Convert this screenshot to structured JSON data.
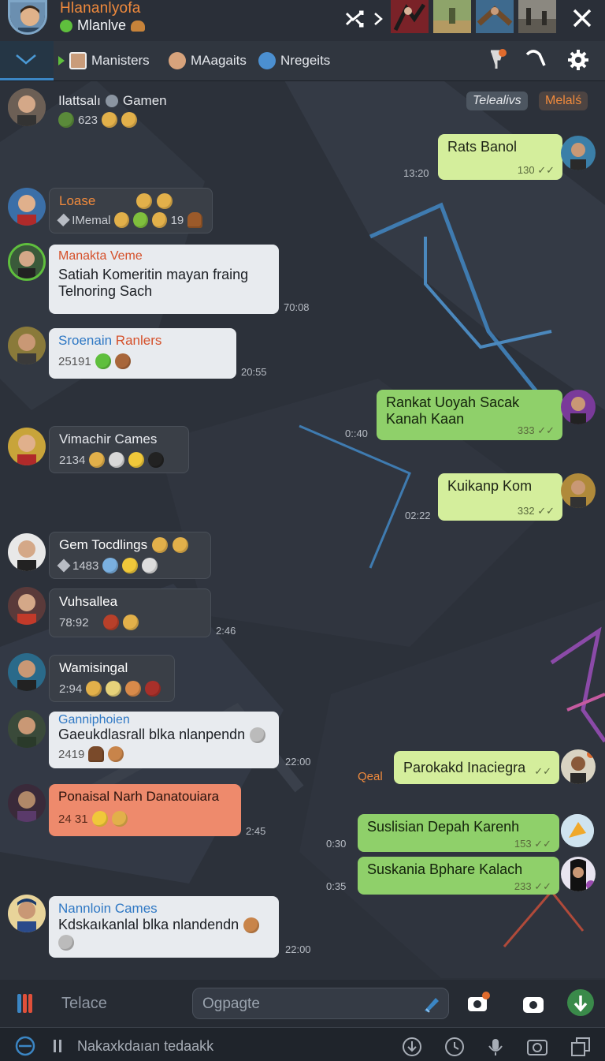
{
  "header": {
    "title": "Hlananlyofa",
    "status": "Mlanlve",
    "status_color": "#5fbf3d"
  },
  "tabs": [
    {
      "label": "Manisters",
      "icon": "image-icon"
    },
    {
      "label": "MAagaits",
      "icon": "face-icon"
    },
    {
      "label": "Nregeits",
      "icon": "globe-icon"
    }
  ],
  "top_row": {
    "name": "Ilattsalı",
    "game": "Gamen",
    "count": "623",
    "pill_1": "Telealivs",
    "pill_2": "Melalś"
  },
  "messages": [
    {
      "id": "m1",
      "text": "Rats Banol",
      "meta": "130",
      "time": "13:20"
    },
    {
      "id": "m2",
      "name": "Loase",
      "sub": "IMemal",
      "num": "19"
    },
    {
      "id": "m3",
      "name": "Manakta Veme",
      "text1": "Satiah Komeritin mayan fraing",
      "text2": "Telnoring Sach",
      "time": "70:08"
    },
    {
      "id": "m4",
      "name_a": "Sroenain",
      "name_b": "Ranlers",
      "sub": "25191",
      "time": "20:55"
    },
    {
      "id": "m5",
      "text1": "Rankat Uoyah Sacak",
      "text2": "Kanah Kaan",
      "meta": "333",
      "time": "0::40"
    },
    {
      "id": "m6",
      "name": "Vimachir Cames",
      "sub": "2134"
    },
    {
      "id": "m7",
      "text": "Kuikanp Kom",
      "meta": "332",
      "time": "02:22"
    },
    {
      "id": "m8",
      "name": "Gem Tocdlings",
      "sub": "1483"
    },
    {
      "id": "m9",
      "name": "Vuhsallea",
      "sub": "78:92",
      "time": "2:46"
    },
    {
      "id": "m10",
      "name": "Wamisingal",
      "sub": "2:94"
    },
    {
      "id": "m11",
      "name": "Ganniphoien",
      "text": "Gaeukdlasrall blka nlanpendn",
      "sub": "2419",
      "time": "22:00"
    },
    {
      "id": "m12",
      "text": "Parokakd Inaciegra",
      "prefix": "Qeal"
    },
    {
      "id": "m13",
      "name": "Ponaisal Narh Danatouiara",
      "sub": "24 31",
      "time": "2:45"
    },
    {
      "id": "m14",
      "text": "Suslisian Depah Karenh",
      "meta": "153",
      "time": "0:30"
    },
    {
      "id": "m15",
      "text": "Suskania Bphare Kalach",
      "meta": "233",
      "time": "0:35"
    },
    {
      "id": "m16",
      "name": "Nannloin Cames",
      "text": "Kdskaıkanlal blka nlandendn",
      "time": "22:00"
    }
  ],
  "composer": {
    "label": "Telace",
    "placeholder": "Ogpagte"
  },
  "footer": {
    "text": "Nakaxkdaıan tedaakk"
  },
  "colors": {
    "accent_orange": "#f08a3c",
    "accent_blue": "#3b86c4",
    "bubble_green": "#d4ee9c",
    "bubble_green_dark": "#8fd06a"
  }
}
